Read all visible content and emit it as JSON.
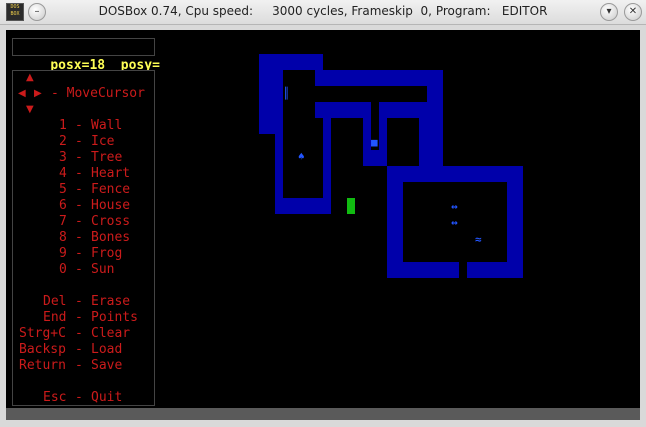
{
  "window": {
    "title": "DOSBox 0.74, Cpu speed:     3000 cycles, Frameskip  0, Program:   EDITOR",
    "icon_label": "DOS BOX"
  },
  "status": {
    "posx_label": "posx=18",
    "posy_label": "posy= B"
  },
  "help": {
    "move_cursor": "- MoveCursor",
    "items": [
      {
        "key": "1",
        "sep": "-",
        "name": "Wall"
      },
      {
        "key": "2",
        "sep": "-",
        "name": "Ice"
      },
      {
        "key": "3",
        "sep": "-",
        "name": "Tree"
      },
      {
        "key": "4",
        "sep": "-",
        "name": "Heart"
      },
      {
        "key": "5",
        "sep": "-",
        "name": "Fence"
      },
      {
        "key": "6",
        "sep": "-",
        "name": "House"
      },
      {
        "key": "7",
        "sep": "-",
        "name": "Cross"
      },
      {
        "key": "8",
        "sep": "-",
        "name": "Bones"
      },
      {
        "key": "9",
        "sep": "-",
        "name": "Frog"
      },
      {
        "key": "0",
        "sep": "-",
        "name": "Sun"
      }
    ],
    "commands": [
      {
        "key": "Del",
        "sep": "-",
        "name": "Erase"
      },
      {
        "key": "End",
        "sep": "-",
        "name": "Points"
      },
      {
        "key": "Strg+C",
        "sep": "-",
        "name": "Clear"
      },
      {
        "key": "Backsp",
        "sep": "-",
        "name": "Load"
      },
      {
        "key": "Return",
        "sep": "-",
        "name": "Save"
      },
      {
        "key": "Esc",
        "sep": "-",
        "name": "Quit"
      }
    ]
  },
  "colors": {
    "wall": "#0000aa",
    "text": "#cc1b1b",
    "status": "#ffff55",
    "cursor": "#11bb11"
  },
  "icons": [
    "minimize-icon",
    "maximize-icon",
    "close-icon",
    "arrow-up-icon",
    "arrow-left-icon",
    "arrow-right-icon",
    "arrow-down-icon"
  ]
}
